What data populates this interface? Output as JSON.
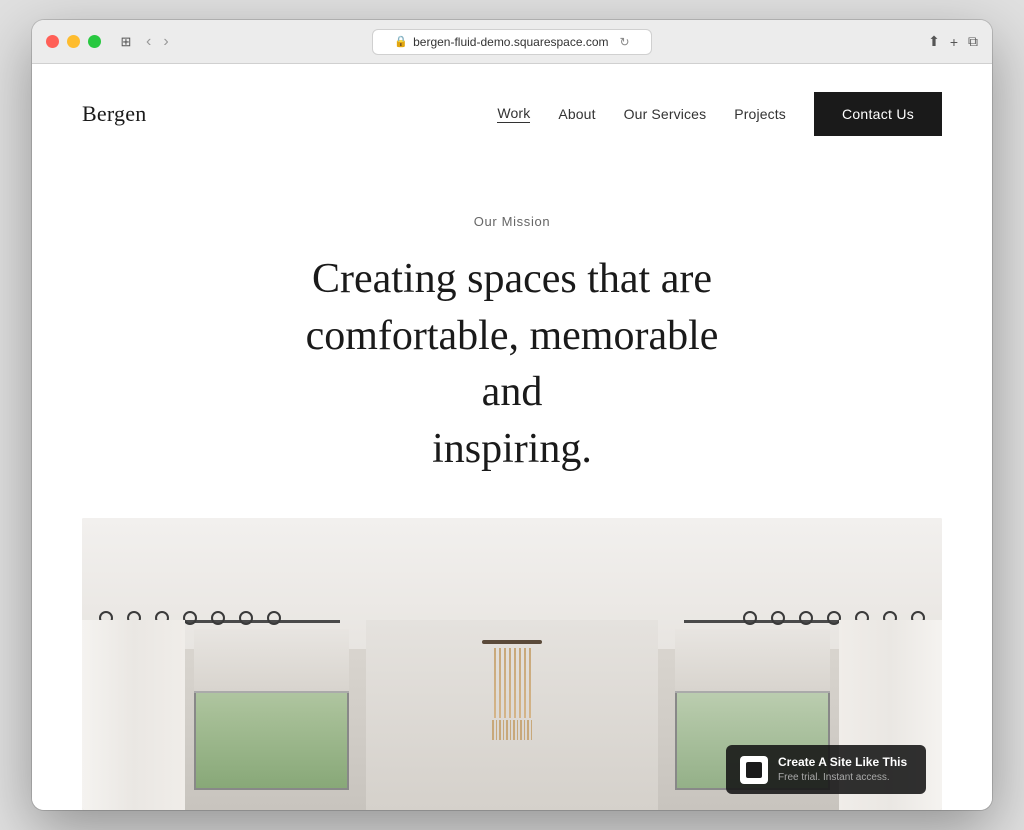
{
  "browser": {
    "url": "bergen-fluid-demo.squarespace.com",
    "lock_icon": "🔒",
    "refresh_icon": "↻"
  },
  "site": {
    "logo": "Bergen",
    "nav": {
      "items": [
        {
          "label": "Work",
          "active": true
        },
        {
          "label": "About",
          "active": false
        },
        {
          "label": "Our Services",
          "active": false
        },
        {
          "label": "Projects",
          "active": false
        }
      ],
      "contact_button": "Contact Us"
    },
    "hero": {
      "label": "Our Mission",
      "heading_line1": "Creating spaces that are",
      "heading_line2": "comfortable, memorable and",
      "heading_line3": "inspiring."
    },
    "squarespace_badge": {
      "title": "Create A Site Like This",
      "subtitle": "Free trial. Instant access."
    }
  }
}
